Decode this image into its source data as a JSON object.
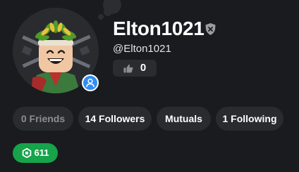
{
  "profile": {
    "display_name": "Elton1021",
    "username": "@Elton1021",
    "vote_count": "0",
    "premium_badge_icon": "user-icon",
    "verified_icon": "shield-x-icon"
  },
  "stats": {
    "friends": "0 Friends",
    "followers": "14 Followers",
    "mutuals": "Mutuals",
    "following": "1 Following"
  },
  "robux": {
    "amount": "611",
    "icon": "robux-icon",
    "color": "#16a34a"
  },
  "colors": {
    "background": "#1a1b1e",
    "pill": "#2a2b2f",
    "premium": "#2f8ef5"
  }
}
